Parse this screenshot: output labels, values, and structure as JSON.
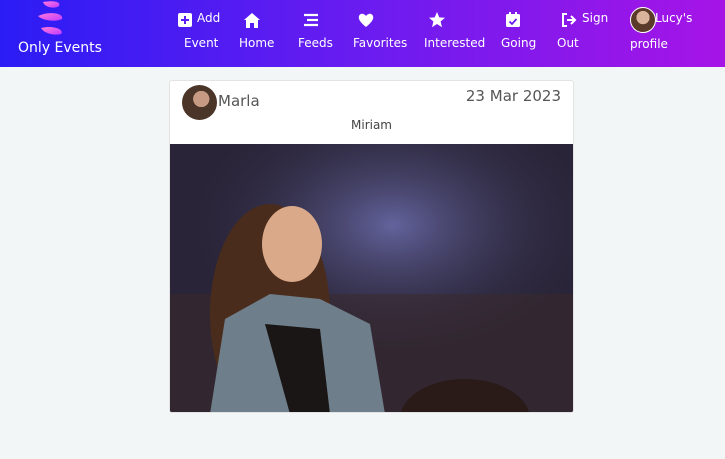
{
  "brand": {
    "name": "Only Events"
  },
  "nav": {
    "items": [
      {
        "id": "add-event",
        "icon": "plus-square-icon",
        "line1": "Add",
        "line2": "Event"
      },
      {
        "id": "home",
        "icon": "home-icon",
        "line1": "",
        "line2": "Home"
      },
      {
        "id": "feeds",
        "icon": "bars-icon",
        "line1": "",
        "line2": "Feeds"
      },
      {
        "id": "favorites",
        "icon": "heart-icon",
        "line1": "",
        "line2": "Favorites"
      },
      {
        "id": "interested",
        "icon": "star-icon",
        "line1": "",
        "line2": "Interested"
      },
      {
        "id": "going",
        "icon": "calendar-check-icon",
        "line1": "",
        "line2": "Going"
      },
      {
        "id": "sign-out",
        "icon": "sign-out-icon",
        "line1": "Sign",
        "line2": "Out"
      }
    ],
    "profile": {
      "line1": "Lucy's",
      "line2": "profile"
    }
  },
  "post": {
    "author": "Marla",
    "date": "23 Mar 2023",
    "title": "Miriam"
  },
  "colors": {
    "nav_start": "#2b1cf5",
    "nav_end": "#a614e6",
    "background": "#f3f6f7"
  }
}
